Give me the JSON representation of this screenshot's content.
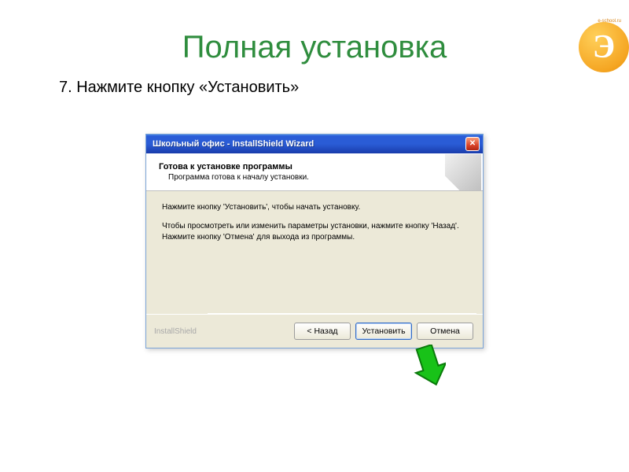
{
  "logo": {
    "letter": "Э",
    "tag": "e-school.ru"
  },
  "slide": {
    "title": "Полная установка",
    "step": "7. Нажмите кнопку «Установить»"
  },
  "wizard": {
    "window_title": "Школьный офис - InstallShield Wizard",
    "close_label": "✕",
    "header_title": "Готова к установке программы",
    "header_sub": "Программа готова к началу установки.",
    "body_line1": "Нажмите кнопку 'Установить', чтобы начать установку.",
    "body_line2": "Чтобы просмотреть или изменить параметры установки, нажмите кнопку 'Назад'. Нажмите кнопку 'Отмена' для выхода из программы.",
    "brand": "InstallShield",
    "btn_back": "< Назад",
    "btn_install": "Установить",
    "btn_cancel": "Отмена"
  }
}
